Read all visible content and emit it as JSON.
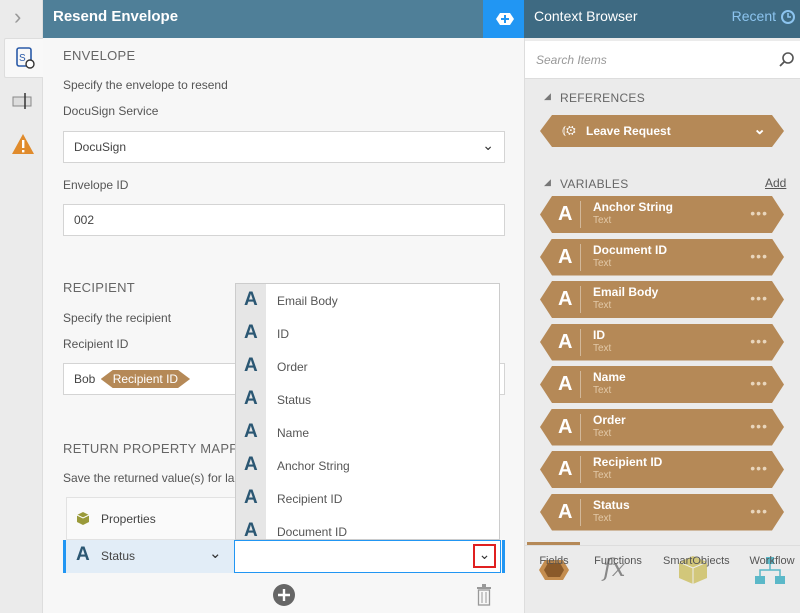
{
  "main": {
    "title": "Resend Envelope",
    "envelope": {
      "heading": "ENVELOPE",
      "description": "Specify the envelope to resend",
      "service_label": "DocuSign Service",
      "service_value": "DocuSign",
      "envelope_id_label": "Envelope ID",
      "envelope_id_value": "002"
    },
    "recipient": {
      "heading": "RECIPIENT",
      "description": "Specify the recipient",
      "id_label": "Recipient ID",
      "id_text": "Bob",
      "id_token": "Recipient ID"
    },
    "return": {
      "heading": "RETURN PROPERTY MAPPING",
      "description": "Save the returned value(s) for la",
      "properties_label": "Properties",
      "row_property": "Status",
      "row_value": ""
    }
  },
  "dropdown_items": [
    "Email Body",
    "ID",
    "Order",
    "Status",
    "Name",
    "Anchor String",
    "Recipient ID",
    "Document ID"
  ],
  "context": {
    "title": "Context Browser",
    "recent": "Recent",
    "search_placeholder": "Search Items",
    "references_heading": "REFERENCES",
    "reference": "Leave Request",
    "variables_heading": "VARIABLES",
    "add": "Add",
    "variables": [
      {
        "name": "Anchor String",
        "type": "Text"
      },
      {
        "name": "Document ID",
        "type": "Text"
      },
      {
        "name": "Email Body",
        "type": "Text"
      },
      {
        "name": "ID",
        "type": "Text"
      },
      {
        "name": "Name",
        "type": "Text"
      },
      {
        "name": "Order",
        "type": "Text"
      },
      {
        "name": "Recipient ID",
        "type": "Text"
      },
      {
        "name": "Status",
        "type": "Text"
      }
    ],
    "tabs": [
      "Fields",
      "Functions",
      "SmartObjects",
      "Workflow"
    ]
  },
  "colors": {
    "tag": "#b58957",
    "accent": "#2196f3",
    "header": "#4f7f98"
  }
}
